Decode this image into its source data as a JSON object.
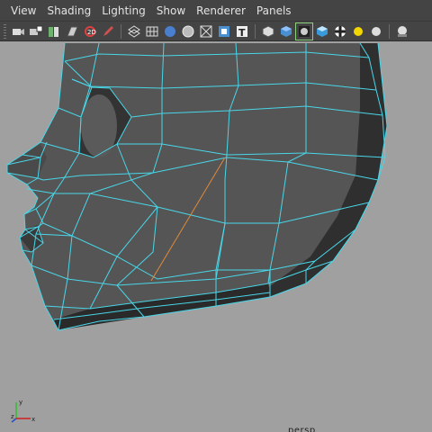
{
  "menubar": {
    "items": [
      "View",
      "Shading",
      "Lighting",
      "Show",
      "Renderer",
      "Panels"
    ]
  },
  "toolbar": {
    "icons": [
      "select-camera-icon",
      "camera-attributes-icon",
      "bookmarks-icon",
      "image-plane-icon",
      "2d-pan-zoom-icon",
      "grease-pencil-icon",
      "wireframe-icon",
      "grid-icon",
      "smooth-shade-icon",
      "flat-shade-icon",
      "xray-icon",
      "xray-joints-icon",
      "textured-icon",
      "default-material-icon",
      "wireframe-on-shaded-icon",
      "smooth-shade-all-icon",
      "checker-icon",
      "use-all-lights-icon",
      "default-light-icon",
      "shadows-icon",
      "isolate-select-icon"
    ]
  },
  "viewport": {
    "camera_label": "persp",
    "axis": {
      "x": "x",
      "y": "y",
      "z": "z"
    },
    "colors": {
      "background": "#a0a0a0",
      "mesh_face": "#555555",
      "wireframe": "#49d6e8",
      "selected_edge": "#e08a3a"
    }
  }
}
